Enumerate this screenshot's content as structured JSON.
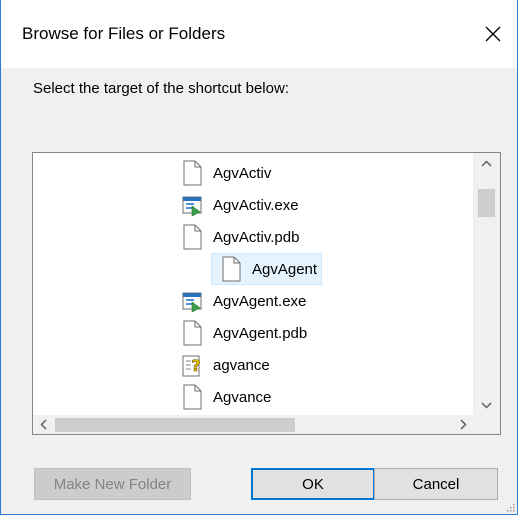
{
  "dialog": {
    "title": "Browse for Files or Folders",
    "instruction": "Select the target of the shortcut below:"
  },
  "tree": {
    "items": [
      {
        "label": "AgvActiv",
        "icon": "document-icon",
        "selected": false
      },
      {
        "label": "AgvActiv.exe",
        "icon": "executable-icon",
        "selected": false
      },
      {
        "label": "AgvActiv.pdb",
        "icon": "document-icon",
        "selected": false
      },
      {
        "label": "AgvAgent",
        "icon": "document-icon",
        "selected": true
      },
      {
        "label": "AgvAgent.exe",
        "icon": "executable-icon",
        "selected": false
      },
      {
        "label": "AgvAgent.pdb",
        "icon": "document-icon",
        "selected": false
      },
      {
        "label": "agvance",
        "icon": "unknown-file-icon",
        "selected": false
      },
      {
        "label": "Agvance",
        "icon": "document-icon",
        "selected": false
      }
    ]
  },
  "buttons": {
    "make_new_folder": "Make New Folder",
    "ok": "OK",
    "cancel": "Cancel"
  },
  "colors": {
    "accent": "#0078d7",
    "selection_bg": "#e5f3ff",
    "dialog_bg": "#f0f0f0"
  }
}
